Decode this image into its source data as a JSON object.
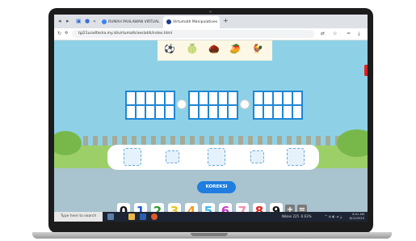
{
  "browser": {
    "tabs": [
      {
        "label": "RUMAH PAHLAWAN VIRTUAL",
        "icon": "globe-icon",
        "active": false
      },
      {
        "label": "Virtumath Manipulatives",
        "icon": "virtumath-icon",
        "active": true
      }
    ],
    "url": "tgi21uradfasha.my.id/virtumath/aeslatih/index.html"
  },
  "app": {
    "fruits": [
      {
        "glyph": "⚽",
        "name": "ball-icon"
      },
      {
        "glyph": "🍈",
        "name": "melon-icon"
      },
      {
        "glyph": "🌰",
        "name": "nut-icon"
      },
      {
        "glyph": "🥭",
        "name": "mango-icon"
      },
      {
        "glyph": "🐓",
        "name": "chicken-icon"
      }
    ],
    "koreksi_label": "KOREKSI",
    "numbers": [
      {
        "text": "0",
        "color": "#111111"
      },
      {
        "text": "1",
        "color": "#1a5bd6"
      },
      {
        "text": "2",
        "color": "#2e9a2e"
      },
      {
        "text": "3",
        "color": "#e8c51c"
      },
      {
        "text": "4",
        "color": "#f29a1c"
      },
      {
        "text": "5",
        "color": "#3bb8e8"
      },
      {
        "text": "6",
        "color": "#c23cc2"
      },
      {
        "text": "7",
        "color": "#f28fb0"
      },
      {
        "text": "8",
        "color": "#e02424"
      },
      {
        "text": "9",
        "color": "#111111"
      }
    ],
    "operators": [
      {
        "text": "+",
        "name": "plus-button"
      },
      {
        "text": "=",
        "name": "equals-button"
      }
    ]
  },
  "taskbar": {
    "search_placeholder": "Type here to search",
    "weather": "Nikkei 225  -0.63%",
    "clock_time": "8:41 AM",
    "clock_date": "8/12/2025"
  },
  "colors": {
    "accent": "#1f7ee0",
    "grid": "#1f86d4"
  }
}
